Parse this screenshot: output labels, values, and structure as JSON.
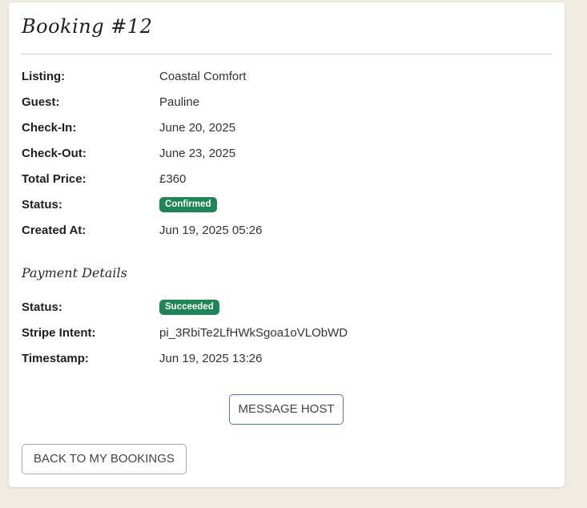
{
  "booking": {
    "title": "Booking #12",
    "rows": [
      {
        "label": "Listing:",
        "value": "Coastal Comfort"
      },
      {
        "label": "Guest:",
        "value": "Pauline"
      },
      {
        "label": "Check-In:",
        "value": "June 20, 2025"
      },
      {
        "label": "Check-Out:",
        "value": "June 23, 2025"
      },
      {
        "label": "Total Price:",
        "value": "£360"
      },
      {
        "label": "Status:",
        "value": "Confirmed"
      },
      {
        "label": "Created At:",
        "value": "Jun 19, 2025 05:26"
      }
    ],
    "status_badge_color": "#1e8557"
  },
  "payment": {
    "heading": "Payment Details",
    "rows": [
      {
        "label": "Status:",
        "value": "Succeeded"
      },
      {
        "label": "Stripe Intent:",
        "value": "pi_3RbiTe2LfHWkSgoa1oVLObWD"
      },
      {
        "label": "Timestamp:",
        "value": "Jun 19, 2025 13:26"
      }
    ],
    "status_badge_color": "#1e8557"
  },
  "actions": {
    "message_host": "MESSAGE HOST",
    "back_to_bookings": "BACK TO MY BOOKINGS"
  },
  "colors": {
    "page_background": "#f1ece1",
    "card_background": "#ffffff",
    "message_button_border": "#4a78d8",
    "back_button_border": "#b0a79a"
  }
}
